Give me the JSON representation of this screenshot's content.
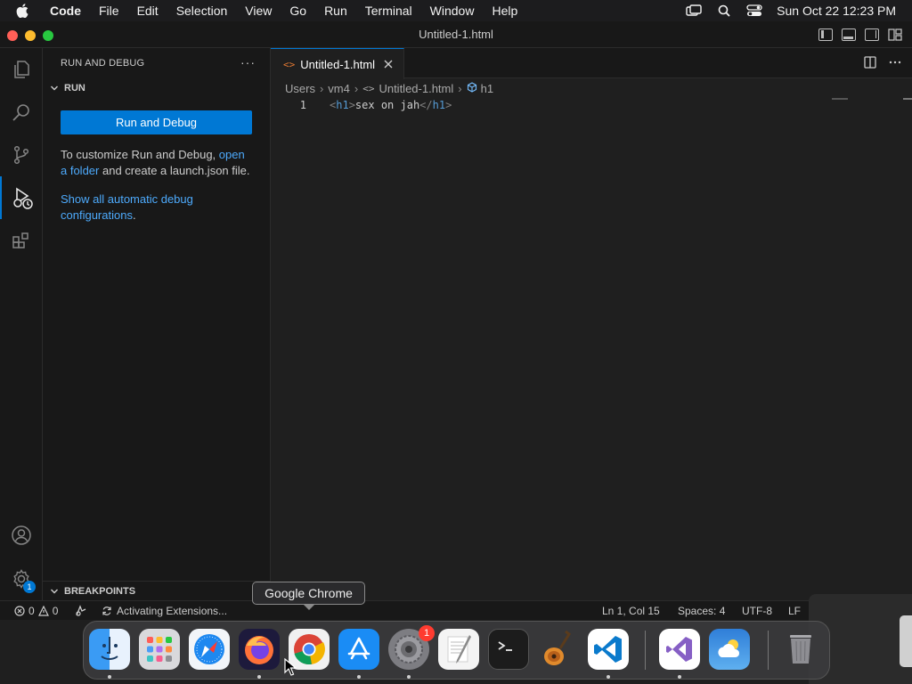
{
  "menubar": {
    "app_name": "Code",
    "items": [
      "File",
      "Edit",
      "Selection",
      "View",
      "Go",
      "Run",
      "Terminal",
      "Window",
      "Help"
    ],
    "clock": "Sun Oct 22  12:23 PM"
  },
  "window": {
    "title": "Untitled-1.html"
  },
  "activity_bar": {
    "accounts_badge": "1"
  },
  "sidebar": {
    "header": "RUN AND DEBUG",
    "more": "···",
    "section_run": "RUN",
    "run_button": "Run and Debug",
    "customize_text_1": "To customize Run and Debug,",
    "customize_link": "open a folder",
    "customize_text_2": "and create a launch.json file.",
    "show_all_link": "Show all automatic debug configurations",
    "show_all_period": ".",
    "section_breakpoints": "BREAKPOINTS"
  },
  "editor": {
    "tab_label": "Untitled-1.html",
    "tab_icon": "<>",
    "breadcrumb": {
      "users": "Users",
      "vm4": "vm4",
      "file": "Untitled-1.html",
      "element": "h1"
    },
    "line_number": "1",
    "code": {
      "open_lt": "<",
      "open_tag": "h1",
      "open_gt": ">",
      "text": "sex on jah",
      "close_lt": "</",
      "close_tag": "h1",
      "close_gt": ">"
    }
  },
  "statusbar": {
    "errors": "0",
    "warnings": "0",
    "activity": "Activating Extensions...",
    "position": "Ln 1, Col 15",
    "spaces": "Spaces: 4",
    "encoding": "UTF-8",
    "eol": "LF"
  },
  "dock": {
    "tooltip": "Google Chrome",
    "settings_badge": "1",
    "apps": [
      "Finder",
      "Launchpad",
      "Safari",
      "Firefox",
      "Google Chrome",
      "App Store",
      "System Settings",
      "TextEdit",
      "Terminal",
      "GarageBand",
      "Visual Studio Code",
      "Visual Studio",
      "Weather",
      "Trash"
    ]
  },
  "colors": {
    "accent": "#0078d4",
    "link": "#4daafc",
    "tag": "#569cd6"
  }
}
